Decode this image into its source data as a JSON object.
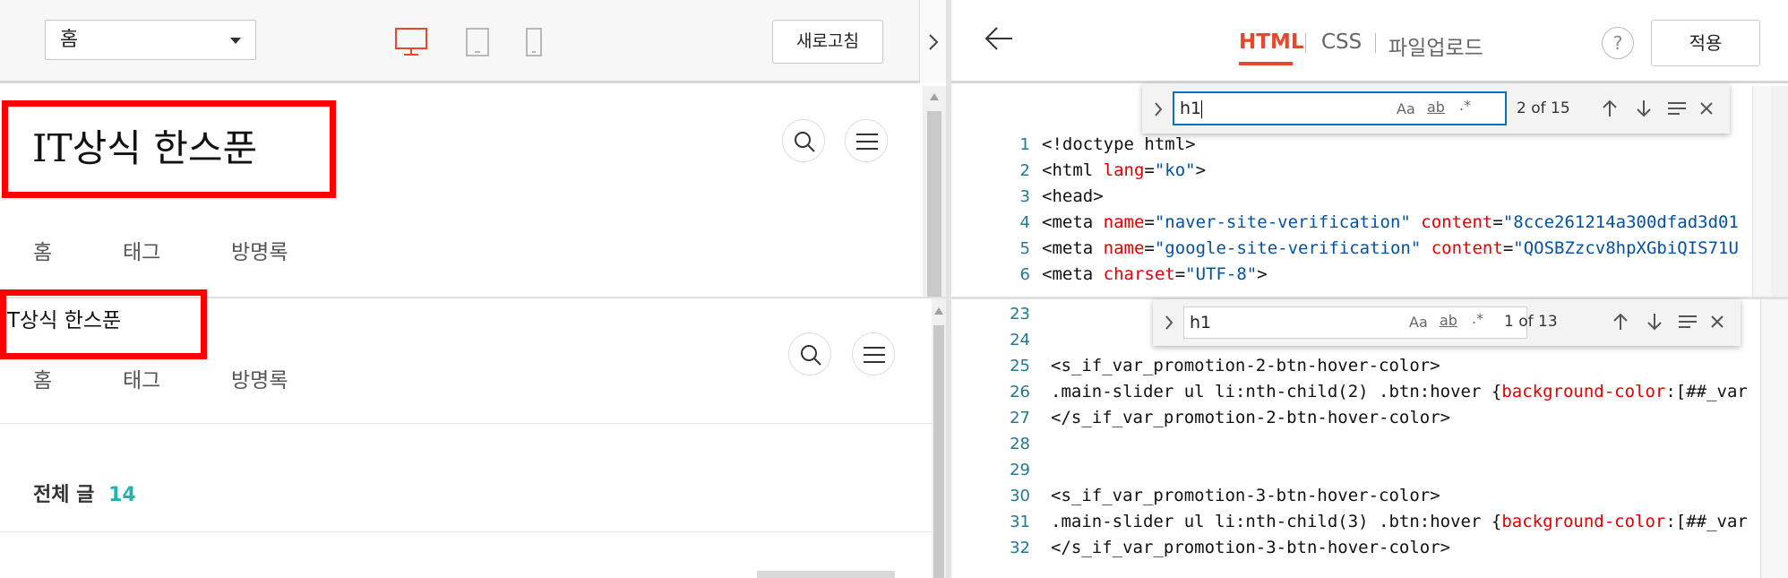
{
  "left_toolbar": {
    "page_select_value": "홈",
    "refresh_label": "새로고침",
    "collapse_icon": "›"
  },
  "preview_top": {
    "blog_title": "IT상식 한스푼",
    "nav": [
      "홈",
      "태그",
      "방명록"
    ]
  },
  "preview_bottom": {
    "blog_title": "T상식 한스푼",
    "nav": [
      "홈",
      "태그",
      "방명록"
    ],
    "post_count_label": "전체 글",
    "post_count": "14"
  },
  "right_toolbar": {
    "back_icon": "←",
    "tabs": [
      "HTML",
      "CSS",
      "파일업로드"
    ],
    "help_label": "?",
    "apply_label": "적용"
  },
  "find_top": {
    "query": "h1",
    "match_case": "Aa",
    "whole_word": "ab",
    "regex": ".*",
    "count": "2 of 15"
  },
  "find_bottom": {
    "query": "h1",
    "match_case": "Aa",
    "whole_word": "ab",
    "regex": ".*",
    "count": "1 of 13"
  },
  "code_top": {
    "line_numbers": [
      "1",
      "2",
      "3",
      "4",
      "5",
      "6"
    ],
    "lines": [
      [
        {
          "t": "<!doctype html>",
          "c": "tag"
        }
      ],
      [
        {
          "t": "<html ",
          "c": "tag"
        },
        {
          "t": "lang",
          "c": "attr"
        },
        {
          "t": "=",
          "c": "tag"
        },
        {
          "t": "\"ko\"",
          "c": "str"
        },
        {
          "t": ">",
          "c": "tag"
        }
      ],
      [
        {
          "t": "<head>",
          "c": "tag"
        }
      ],
      [
        {
          "t": "<meta ",
          "c": "tag"
        },
        {
          "t": "name",
          "c": "attr"
        },
        {
          "t": "=",
          "c": "tag"
        },
        {
          "t": "\"naver-site-verification\"",
          "c": "str"
        },
        {
          "t": " ",
          "c": "tag"
        },
        {
          "t": "content",
          "c": "attr"
        },
        {
          "t": "=",
          "c": "tag"
        },
        {
          "t": "\"8cce261214a300dfad3d01",
          "c": "str"
        }
      ],
      [
        {
          "t": "<meta ",
          "c": "tag"
        },
        {
          "t": "name",
          "c": "attr"
        },
        {
          "t": "=",
          "c": "tag"
        },
        {
          "t": "\"google-site-verification\"",
          "c": "str"
        },
        {
          "t": " ",
          "c": "tag"
        },
        {
          "t": "content",
          "c": "attr"
        },
        {
          "t": "=",
          "c": "tag"
        },
        {
          "t": "\"QOSBZzcv8hpXGbiQIS71U",
          "c": "str"
        }
      ],
      [
        {
          "t": "<meta ",
          "c": "tag"
        },
        {
          "t": "charset",
          "c": "attr"
        },
        {
          "t": "=",
          "c": "tag"
        },
        {
          "t": "\"UTF-8\"",
          "c": "str"
        },
        {
          "t": ">",
          "c": "tag"
        }
      ]
    ]
  },
  "code_bottom": {
    "line_numbers": [
      "23",
      "24",
      "25",
      "26",
      "27",
      "28",
      "29",
      "30",
      "31",
      "32"
    ],
    "lines": [
      [],
      [],
      [
        {
          "t": "<s_if_var_promotion-2-btn-hover-color>",
          "c": "tag"
        }
      ],
      [
        {
          "t": ".main-slider ul li:nth-child(2) .btn:hover {",
          "c": "tag"
        },
        {
          "t": "background-color",
          "c": "attr"
        },
        {
          "t": ":[##_var",
          "c": "tag"
        }
      ],
      [
        {
          "t": "</s_if_var_promotion-2-btn-hover-color>",
          "c": "tag"
        }
      ],
      [],
      [],
      [
        {
          "t": "<s_if_var_promotion-3-btn-hover-color>",
          "c": "tag"
        }
      ],
      [
        {
          "t": ".main-slider ul li:nth-child(3) .btn:hover {",
          "c": "tag"
        },
        {
          "t": "background-color",
          "c": "attr"
        },
        {
          "t": ":[##_var",
          "c": "tag"
        }
      ],
      [
        {
          "t": "</s_if_var_promotion-3-btn-hover-color>",
          "c": "tag"
        }
      ]
    ]
  },
  "colors": {
    "accent": "#e8472b",
    "highlight_box": "#ff0000",
    "count_teal": "#26b3ae"
  }
}
